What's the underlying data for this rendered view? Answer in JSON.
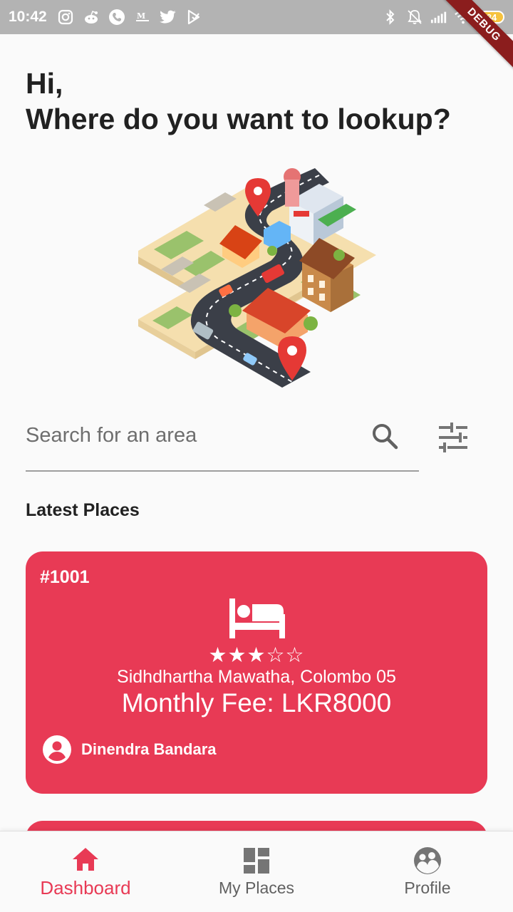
{
  "status_bar": {
    "time": "10:42",
    "battery": "84",
    "icons_left": [
      "instagram-icon",
      "reddit-icon",
      "phone-icon",
      "gmail-icon",
      "twitter-icon",
      "play-icon"
    ],
    "icons_right": [
      "bluetooth-icon",
      "mute-icon",
      "signal-icon",
      "wifi-icon",
      "battery-icon"
    ]
  },
  "debug_banner": "DEBUG",
  "header": {
    "line1": "Hi,",
    "line2": "Where do you want to lookup?"
  },
  "illustration": {
    "icon": "isometric-city-map-illustration"
  },
  "search": {
    "placeholder": "Search for an area",
    "value": "",
    "search_icon": "search-icon",
    "filter_icon": "tune-icon"
  },
  "latest_places": {
    "title": "Latest Places",
    "items": [
      {
        "id": "#1001",
        "icon": "bed-icon",
        "stars": "★★★☆☆",
        "rating": 3,
        "max_rating": 5,
        "address": "Sidhdhartha Mawatha, Colombo 05",
        "fee": "Monthly Fee: LKR8000",
        "owner": "Dinendra Bandara",
        "card_color": "#e83a55"
      }
    ]
  },
  "bottom_nav": {
    "items": [
      {
        "label": "Dashboard",
        "icon": "home-icon",
        "active": true
      },
      {
        "label": "My Places",
        "icon": "dashboard-grid-icon",
        "active": false
      },
      {
        "label": "Profile",
        "icon": "profile-icon",
        "active": false
      }
    ],
    "active_color": "#e83a55",
    "inactive_color": "#616161"
  }
}
